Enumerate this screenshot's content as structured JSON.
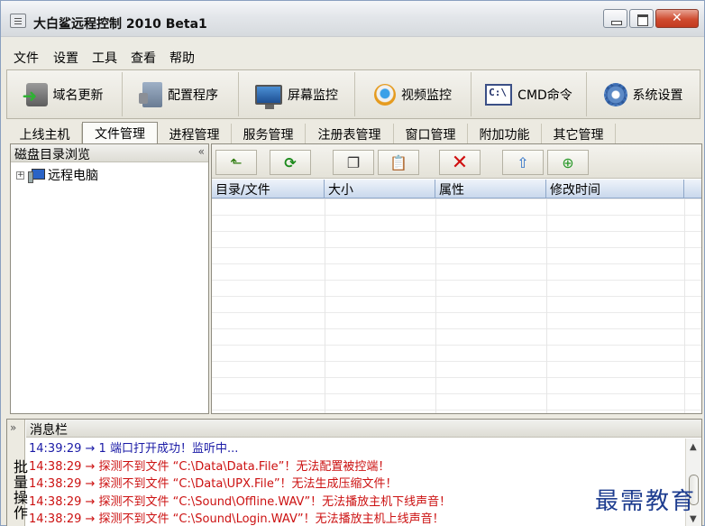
{
  "window": {
    "title": "大白鲨远程控制",
    "version": "2010 Beta1"
  },
  "menu": [
    "文件",
    "设置",
    "工具",
    "查看",
    "帮助"
  ],
  "toolbar": [
    {
      "label": "域名更新",
      "icon": "domain-update-icon"
    },
    {
      "label": "配置程序",
      "icon": "config-program-icon"
    },
    {
      "label": "屏幕监控",
      "icon": "screen-monitor-icon"
    },
    {
      "label": "视频监控",
      "icon": "webcam-icon"
    },
    {
      "label": "CMD命令",
      "icon": "cmd-icon"
    },
    {
      "label": "系统设置",
      "icon": "settings-gear-icon"
    }
  ],
  "tabs": [
    "上线主机",
    "文件管理",
    "进程管理",
    "服务管理",
    "注册表管理",
    "窗口管理",
    "附加功能",
    "其它管理"
  ],
  "active_tab": "文件管理",
  "left_panel": {
    "title": "磁盘目录浏览",
    "collapse": "«",
    "tree": [
      {
        "expander": "+",
        "label": "远程电脑",
        "icon": "computer-icon"
      }
    ]
  },
  "file_toolbar": [
    {
      "name": "up-folder",
      "icon": "folder-up-icon",
      "glyph": "⬑"
    },
    {
      "name": "refresh",
      "icon": "refresh-icon",
      "glyph": "⟳"
    },
    {
      "name": "copy",
      "icon": "copy-icon",
      "glyph": "❐"
    },
    {
      "name": "paste",
      "icon": "paste-icon",
      "glyph": "📋"
    },
    {
      "name": "delete",
      "icon": "delete-icon",
      "glyph": "✕"
    },
    {
      "name": "upload",
      "icon": "upload-icon",
      "glyph": "⇧"
    },
    {
      "name": "download",
      "icon": "download-icon",
      "glyph": "⊕"
    }
  ],
  "file_table": {
    "columns": [
      "目录/文件",
      "大小",
      "属性",
      "修改时间"
    ],
    "rows": []
  },
  "message_panel": {
    "side_label": "批量操作",
    "expand": "»",
    "title": "消息栏",
    "lines": [
      {
        "type": "info",
        "text": "14:39:29 → 1 端口打开成功！监听中..."
      },
      {
        "type": "err",
        "text": "14:38:29 → 探测不到文件 “C:\\Data\\Data.File”！无法配置被控端！"
      },
      {
        "type": "err",
        "text": "14:38:29 → 探测不到文件 “C:\\Data\\UPX.File”！无法生成压缩文件！"
      },
      {
        "type": "err",
        "text": "14:38:29 → 探测不到文件 “C:\\Sound\\Offline.WAV”！无法播放主机下线声音！"
      },
      {
        "type": "err",
        "text": "14:38:29 → 探测不到文件 “C:\\Sound\\Login.WAV”！无法播放主机上线声音！"
      }
    ]
  },
  "watermark": "最需教育"
}
